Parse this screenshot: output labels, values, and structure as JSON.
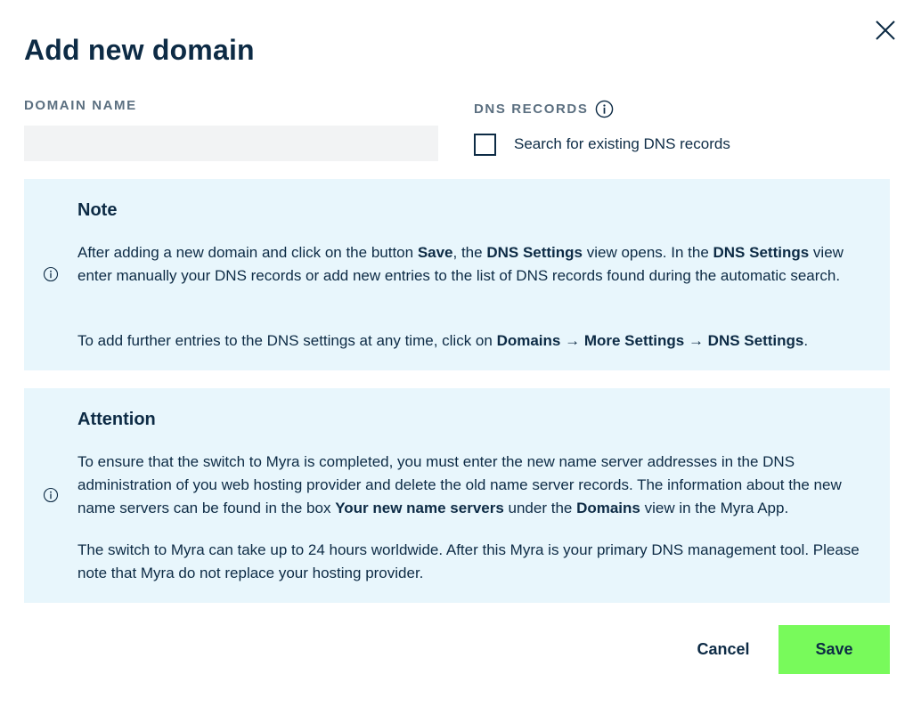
{
  "dialog": {
    "title": "Add new domain"
  },
  "form": {
    "domain_label": "DOMAIN NAME",
    "domain_value": "",
    "domain_placeholder": "",
    "dns_label": "DNS RECORDS",
    "dns_checkbox_label": "Search for existing DNS records",
    "dns_checkbox_checked": false
  },
  "note": {
    "title": "Note",
    "p1": [
      {
        "t": "After adding a new domain and click on the button ",
        "b": false
      },
      {
        "t": "Save",
        "b": true
      },
      {
        "t": ", the ",
        "b": false
      },
      {
        "t": "DNS Settings",
        "b": true
      },
      {
        "t": " view opens. In the ",
        "b": false
      },
      {
        "t": "DNS Settings",
        "b": true
      },
      {
        "t": " view enter manually your DNS records or add new entries to the list of DNS records found during the automatic search.",
        "b": false
      }
    ],
    "p2": [
      {
        "t": "To add further entries to the DNS settings at any time, click on ",
        "b": false
      },
      {
        "t": "Domains",
        "b": true
      },
      {
        "t": " → ",
        "b": false
      },
      {
        "t": "More Settings",
        "b": true
      },
      {
        "t": " → ",
        "b": false
      },
      {
        "t": "DNS Settings",
        "b": true
      },
      {
        "t": ".",
        "b": false
      }
    ]
  },
  "attention": {
    "title": "Attention",
    "p1": [
      {
        "t": "To ensure that the switch to Myra is completed, you must enter the new name server addresses in the DNS administration of you web hosting provider and delete the old name server records. The information about the new name servers can be found in the box ",
        "b": false
      },
      {
        "t": "Your new name servers",
        "b": true
      },
      {
        "t": " under the ",
        "b": false
      },
      {
        "t": "Domains",
        "b": true
      },
      {
        "t": " view in the Myra App.",
        "b": false
      }
    ],
    "p2": [
      {
        "t": "The switch to Myra can take up to 24 hours worldwide. After this Myra is your primary DNS management tool. Please note that Myra do not replace your hosting provider.",
        "b": false
      }
    ]
  },
  "actions": {
    "cancel_label": "Cancel",
    "save_label": "Save"
  },
  "colors": {
    "text": "#0d2b45",
    "label": "#5b6f80",
    "panel_bg": "#e8f6fc",
    "input_bg": "#f2f3f4",
    "save_bg": "#78fa5b"
  },
  "icons": {
    "close": "close-icon",
    "dns_info": "info-icon",
    "panel_info": "info-icon"
  }
}
